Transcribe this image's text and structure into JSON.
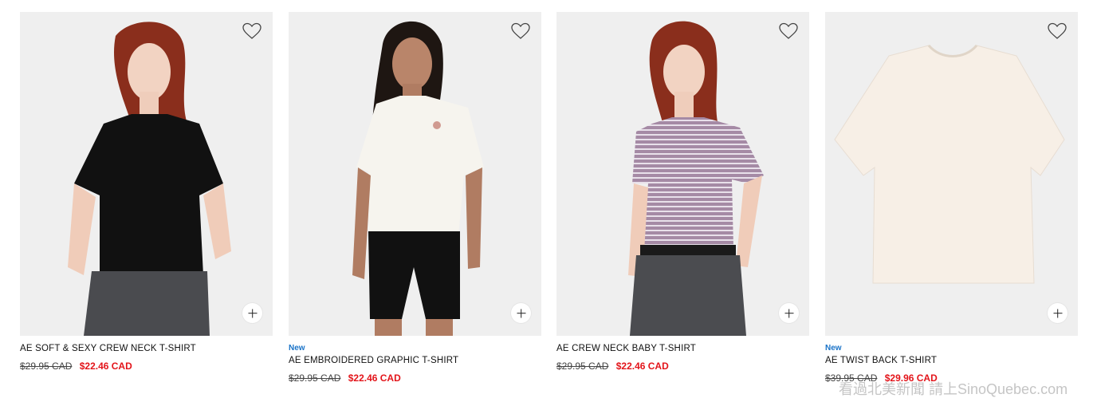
{
  "products": [
    {
      "badge": "",
      "name": "AE SOFT & SEXY CREW NECK T-SHIRT",
      "was_price": "$29.95 CAD",
      "sale_price": "$22.46 CAD"
    },
    {
      "badge": "New",
      "name": "AE EMBROIDERED GRAPHIC T-SHIRT",
      "was_price": "$29.95 CAD",
      "sale_price": "$22.46 CAD"
    },
    {
      "badge": "",
      "name": "AE CREW NECK BABY T-SHIRT",
      "was_price": "$29.95 CAD",
      "sale_price": "$22.46 CAD"
    },
    {
      "badge": "New",
      "name": "AE TWIST BACK T-SHIRT",
      "was_price": "$39.95 CAD",
      "sale_price": "$29.96 CAD"
    }
  ],
  "icons": {
    "favorite": "heart-outline-icon",
    "add": "plus-icon"
  },
  "colors": {
    "sale_price": "#e3141a",
    "new_badge": "#1a73c8",
    "image_bg": "#efefef"
  },
  "watermark": "看過北美新聞 請上SinoQuebec.com"
}
